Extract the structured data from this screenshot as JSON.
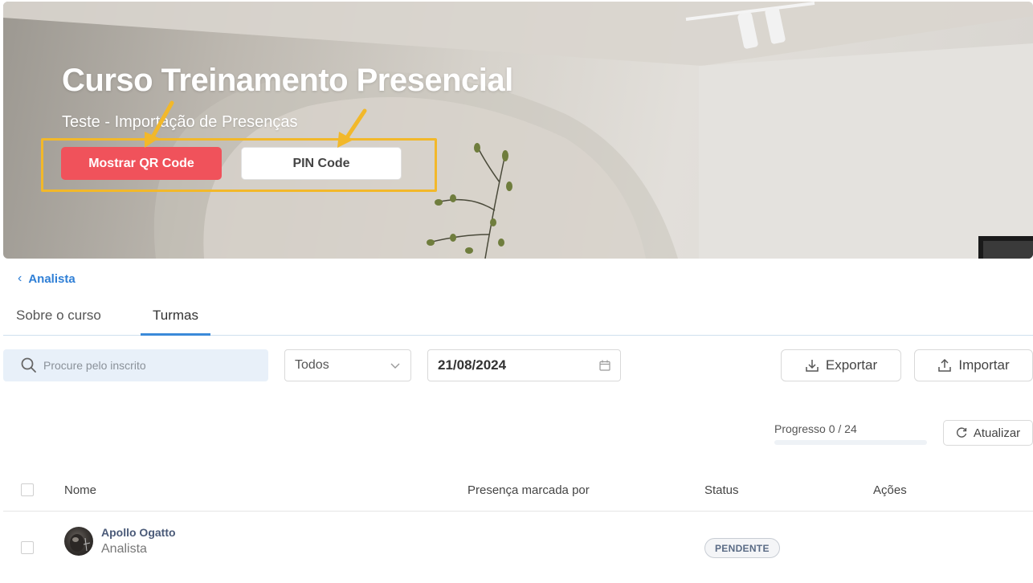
{
  "hero": {
    "title": "Curso Treinamento Presencial",
    "subtitle": "Teste - Importação de Presenças",
    "qr_button": "Mostrar QR Code",
    "pin_button": "PIN Code"
  },
  "nav": {
    "back_label": "Analista"
  },
  "tabs": [
    {
      "label": "Sobre o curso",
      "active": false
    },
    {
      "label": "Turmas",
      "active": true
    }
  ],
  "filters": {
    "search_placeholder": "Procure pelo inscrito",
    "status_select": "Todos",
    "date": "21/08/2024",
    "export_label": "Exportar",
    "import_label": "Importar"
  },
  "progress": {
    "label": "Progresso 0 / 24",
    "done": 0,
    "total": 24,
    "refresh_label": "Atualizar"
  },
  "table": {
    "columns": [
      "Nome",
      "Presença marcada por",
      "Status",
      "Ações"
    ],
    "rows": [
      {
        "name": "Apollo Ogatto",
        "role": "Analista",
        "marked_by": "",
        "status": "PENDENTE"
      }
    ]
  },
  "colors": {
    "primary_red": "#f0525b",
    "accent_blue": "#3b8ad9",
    "annotation_yellow": "#f2b82a"
  }
}
